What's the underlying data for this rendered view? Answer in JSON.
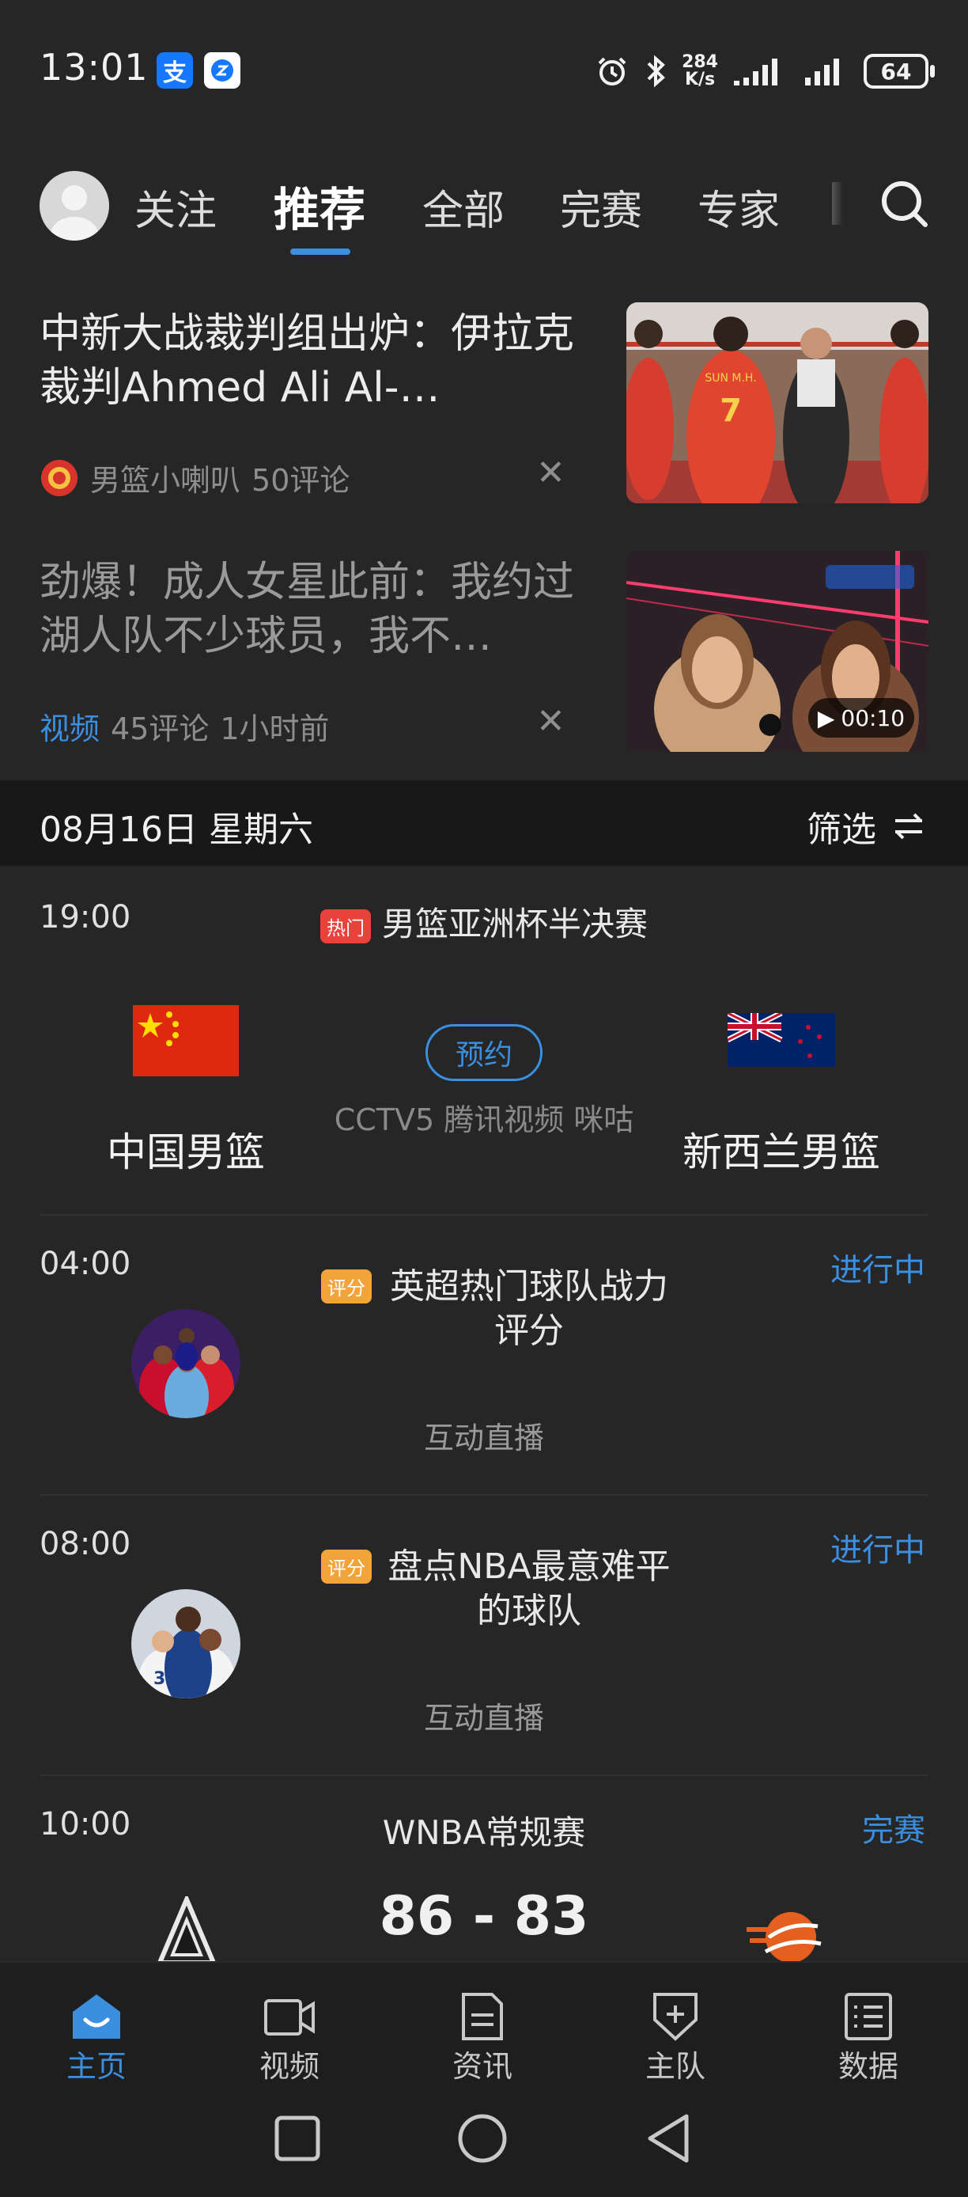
{
  "status_bar": {
    "time": "13:01",
    "app_icon_1": "支",
    "net_speed_value": "284",
    "net_speed_unit": "K/s",
    "battery": "64"
  },
  "top_tabs": {
    "items": [
      "关注",
      "推荐",
      "全部",
      "完赛",
      "专家"
    ],
    "active": "推荐"
  },
  "news": [
    {
      "title": "中新大战裁判组出炉：伊拉克裁判Ahmed Ali Al-…",
      "source": "男篮小喇叭",
      "comments": "50评论"
    },
    {
      "title": "劲爆！成人女星此前：我约过湖人队不少球员，我不…",
      "tag": "视频",
      "comments": "45评论",
      "time_ago": "1小时前",
      "video_duration": "00:10"
    }
  ],
  "date_bar": {
    "date": "08月16日 星期六",
    "filter_label": "筛选"
  },
  "matches": [
    {
      "time": "19:00",
      "badge": "热门",
      "title": "男篮亚洲杯半决赛",
      "home_team": "中国男篮",
      "away_team": "新西兰男篮",
      "reserve_label": "预约",
      "channels": "CCTV5 腾讯视频 咪咕"
    },
    {
      "time": "04:00",
      "status": "进行中",
      "badge": "评分",
      "title": "英超热门球队战力评分",
      "live_label": "互动直播"
    },
    {
      "time": "08:00",
      "status": "进行中",
      "badge": "评分",
      "title": "盘点NBA最意难平的球队",
      "live_label": "互动直播"
    },
    {
      "time": "10:00",
      "status": "完赛",
      "title": "WNBA常规赛",
      "score": "86 - 83"
    }
  ],
  "bottom_nav": {
    "items": [
      "主页",
      "视频",
      "资讯",
      "主队",
      "数据"
    ],
    "active": "主页"
  },
  "colors": {
    "accent": "#3b8fe0",
    "background": "#262626",
    "hot_badge": "#e8423b",
    "rate_badge": "#f2a33a"
  }
}
